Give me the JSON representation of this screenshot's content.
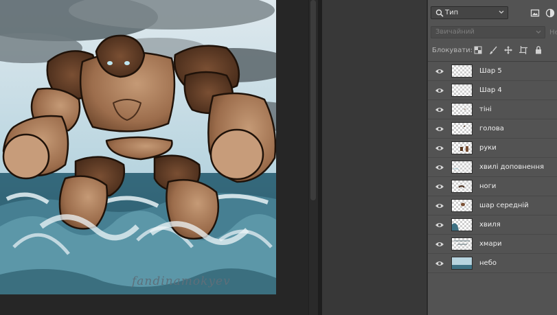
{
  "canvas": {
    "signature": "fandinamokyev"
  },
  "layers_panel": {
    "filter": {
      "label": "Тип",
      "icon": "search-icon"
    },
    "blend_mode": "Звичайний",
    "opacity_label": "Не",
    "lock_label": "Блокувати:",
    "layers": [
      {
        "name": "Шар 5",
        "visible": true,
        "thumb": "empty"
      },
      {
        "name": "Шар 4",
        "visible": true,
        "thumb": "empty"
      },
      {
        "name": "тіні",
        "visible": true,
        "thumb": "dots"
      },
      {
        "name": "голова",
        "visible": true,
        "thumb": "dots"
      },
      {
        "name": "руки",
        "visible": true,
        "thumb": "arms"
      },
      {
        "name": "хвилі доповнення",
        "visible": true,
        "thumb": "waves-light"
      },
      {
        "name": "ноги",
        "visible": true,
        "thumb": "legs"
      },
      {
        "name": "шар середній",
        "visible": true,
        "thumb": "body"
      },
      {
        "name": "хвиля",
        "visible": true,
        "thumb": "wave"
      },
      {
        "name": "хмари",
        "visible": true,
        "thumb": "clouds"
      },
      {
        "name": "небо",
        "visible": true,
        "thumb": "sky"
      }
    ]
  },
  "colors": {
    "panel_bg": "#535353",
    "canvas_bg": "#262626",
    "sky": "#bcd6de",
    "sea": "#3e7183",
    "robot": "#a0704b"
  }
}
